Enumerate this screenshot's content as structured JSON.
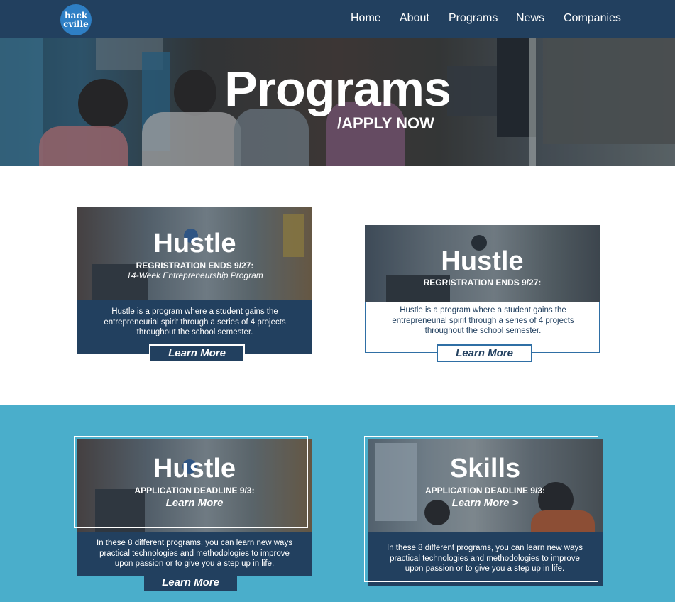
{
  "header": {
    "logo_line1": "hack",
    "logo_line2": "cville",
    "nav": [
      "Home",
      "About",
      "Programs",
      "News",
      "Companies"
    ]
  },
  "hero": {
    "title": "Programs",
    "subtitle": "/APPLY NOW"
  },
  "cards": [
    {
      "title": "Hustle",
      "meta": "REGRISTRATION ENDS 9/27:",
      "tagline": "14-Week Entrepreneurship Program",
      "description": "Hustle is a program where a student gains the entrepreneurial spirit through a series of 4 projects throughout the school semester.",
      "button": "Learn More"
    },
    {
      "title": "Hustle",
      "meta": "REGRISTRATION ENDS 9/27:",
      "description": "Hustle is a program where a student gains the entrepreneurial spirit through a series of 4 projects throughout the school semester.",
      "button": "Learn More"
    },
    {
      "title": "Hustle",
      "meta": "APPLICATION DEADLINE 9/3:",
      "inline_link": "Learn More",
      "description": "In these 8 different programs, you can learn new ways practical technologies and methodologies to improve upon passion or to give you a step up in life.",
      "button": "Learn More"
    },
    {
      "title": "Skills",
      "meta": "APPLICATION DEADLINE 9/3:",
      "inline_link": "Learn More >",
      "description": "In these 8 different programs, you can learn new ways practical technologies and methodologies to improve upon passion or to give you a step up in life."
    }
  ],
  "colors": {
    "navy": "#22405f",
    "brand_blue": "#2e7fc5",
    "section_blue": "#4aaecb"
  }
}
